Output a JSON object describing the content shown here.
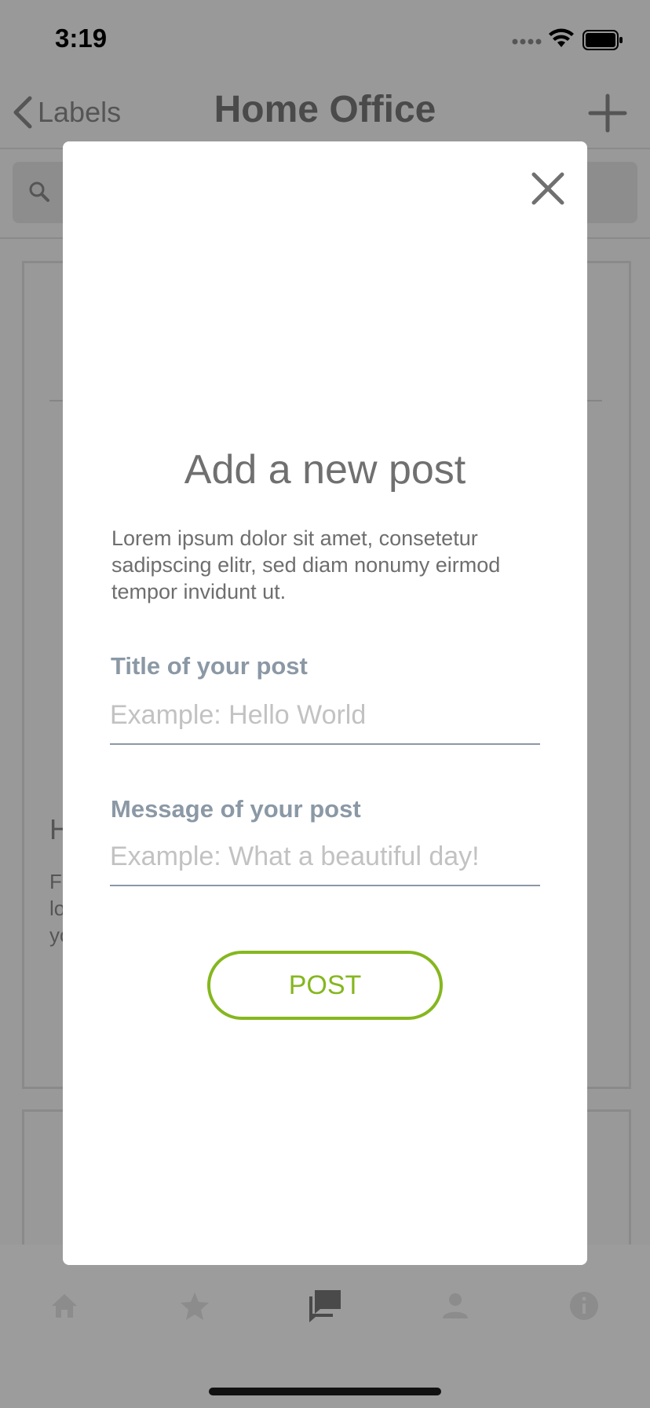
{
  "status_bar": {
    "time": "3:19"
  },
  "nav": {
    "back_label": "Labels",
    "title": "Home Office"
  },
  "background": {
    "card_heading": "H",
    "card_text_lines": [
      "Fl",
      "lo",
      "yo"
    ]
  },
  "modal": {
    "title": "Add a new post",
    "description": "Lorem ipsum dolor sit amet, consetetur sadipscing elitr, sed diam nonumy eirmod tempor invidunt ut.",
    "title_field": {
      "label": "Title of your post",
      "value": "",
      "placeholder": "Example: Hello World"
    },
    "message_field": {
      "label": "Message of your post",
      "value": "",
      "placeholder": "Example: What a beautiful day!"
    },
    "post_button_label": "POST"
  },
  "tab_bar": {
    "items": [
      {
        "icon": "home-icon"
      },
      {
        "icon": "star-icon"
      },
      {
        "icon": "forum-icon",
        "active": true
      },
      {
        "icon": "person-icon"
      },
      {
        "icon": "info-icon"
      }
    ]
  },
  "colors": {
    "accent": "#85b71e",
    "overlay": "#999999",
    "label": "#8b98a5"
  }
}
